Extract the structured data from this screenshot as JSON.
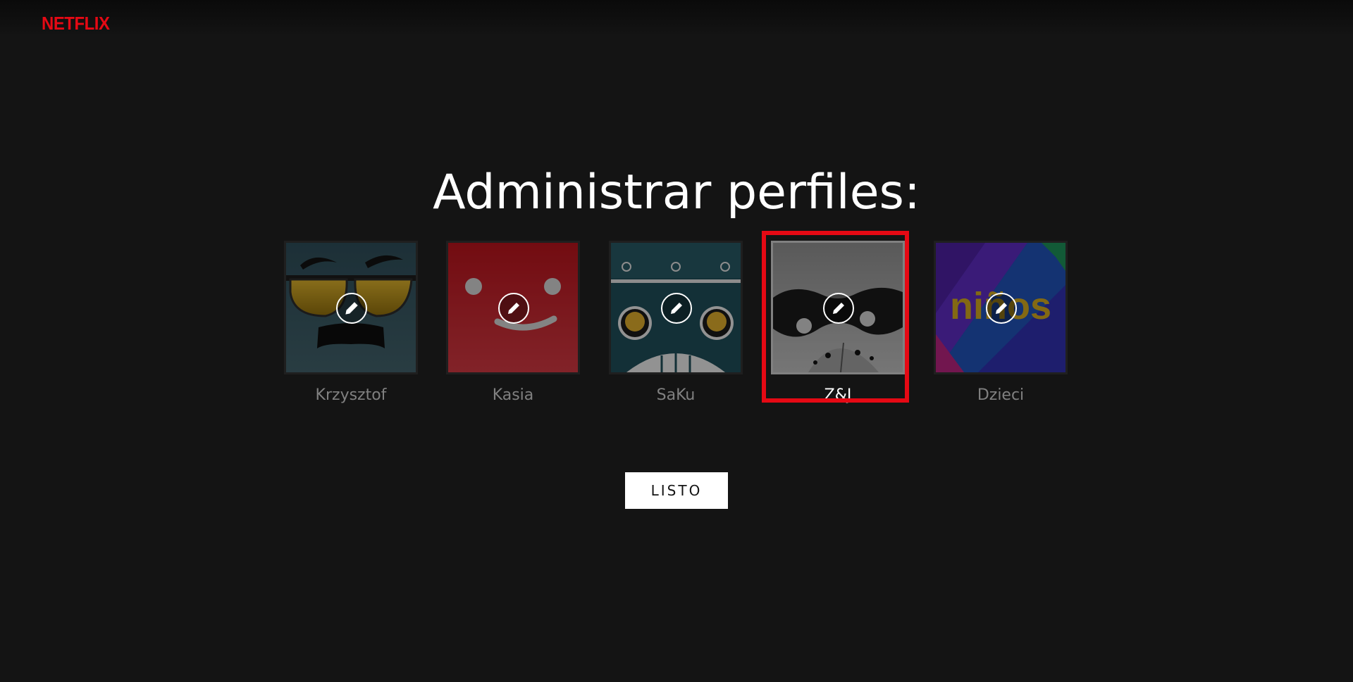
{
  "brand": {
    "logo_text": "NETFLIX",
    "logo_color": "#e50914"
  },
  "page": {
    "title": "Administrar perfiles:"
  },
  "profiles": [
    {
      "name": "Krzysztof",
      "avatar": "sunglasses-mustache-avatar",
      "selected": false
    },
    {
      "name": "Kasia",
      "avatar": "red-smile-avatar",
      "selected": false
    },
    {
      "name": "SaKu",
      "avatar": "robot-avatar",
      "selected": false
    },
    {
      "name": "Z&J",
      "avatar": "gray-mask-avatar",
      "selected": true
    },
    {
      "name": "Dzieci",
      "avatar": "ninos-kids-avatar",
      "selected": false
    }
  ],
  "actions": {
    "done_label": "LISTO"
  },
  "colors": {
    "background": "#141414",
    "selection_outline": "#e50914",
    "inactive_name": "#808080",
    "active_name": "#ffffff"
  },
  "icons": {
    "edit": "pencil-icon"
  }
}
